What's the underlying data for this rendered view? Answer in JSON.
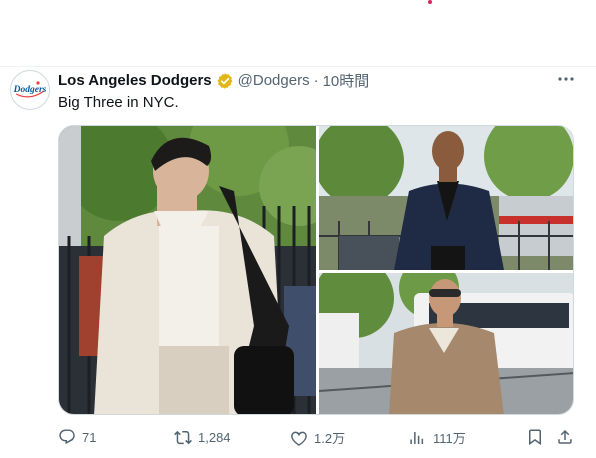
{
  "tweet": {
    "author_name": "Los Angeles Dodgers",
    "handle": "@Dodgers",
    "separator": "·",
    "time": "10時間",
    "text": "Big Three in NYC.",
    "avatar_logo_text": "Dodgers"
  },
  "actions": {
    "replies": "71",
    "retweets": "1,284",
    "likes": "1.2万",
    "views": "111万"
  },
  "icons": [
    "more-icon",
    "verified-badge-icon",
    "reply-icon",
    "retweet-icon",
    "like-icon",
    "views-icon",
    "bookmark-icon",
    "share-icon"
  ],
  "colors": {
    "accent_blue": "#005a9c",
    "verified_gold": "#e2b719",
    "secondary_text": "#536471",
    "notification_dot": "#e0245e"
  }
}
